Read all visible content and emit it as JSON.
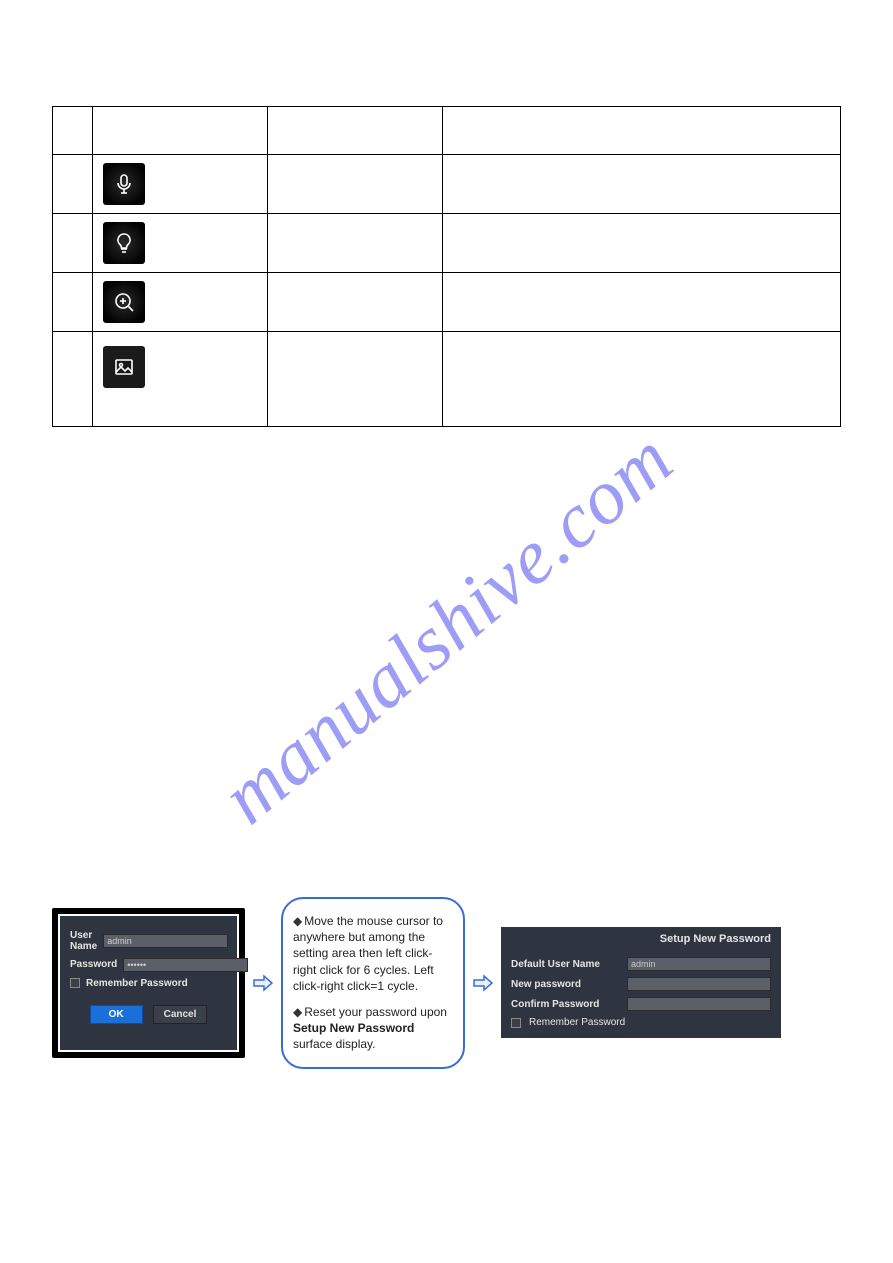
{
  "watermark": "manualshive.com",
  "table": {
    "rows": [
      {
        "icon": "",
        "name": "",
        "desc": ""
      },
      {
        "icon": "mic-icon",
        "name": "",
        "desc": ""
      },
      {
        "icon": "bulb-icon",
        "name": "",
        "desc": ""
      },
      {
        "icon": "zoom-in-icon",
        "name": "",
        "desc": ""
      },
      {
        "icon": "image-icon",
        "name": "",
        "desc": ""
      }
    ]
  },
  "login": {
    "user_label": "User Name",
    "user_value": "admin",
    "pass_label": "Password",
    "pass_value": "••••••",
    "remember": "Remember Password",
    "ok": "OK",
    "cancel": "Cancel"
  },
  "note": {
    "line1a": "Move the mouse cursor to anywhere but among the setting area then left click-right click for 6 cycles. Left click-right click=1 cycle.",
    "line2a": "Reset your password upon ",
    "line2b": "Setup New Password",
    "line2c": " surface display."
  },
  "setup": {
    "title": "Setup New Password",
    "default_user_label": "Default User Name",
    "default_user_value": "admin",
    "new_pass_label": "New password",
    "confirm_label": "Confirm Password",
    "remember": "Remember Password"
  }
}
